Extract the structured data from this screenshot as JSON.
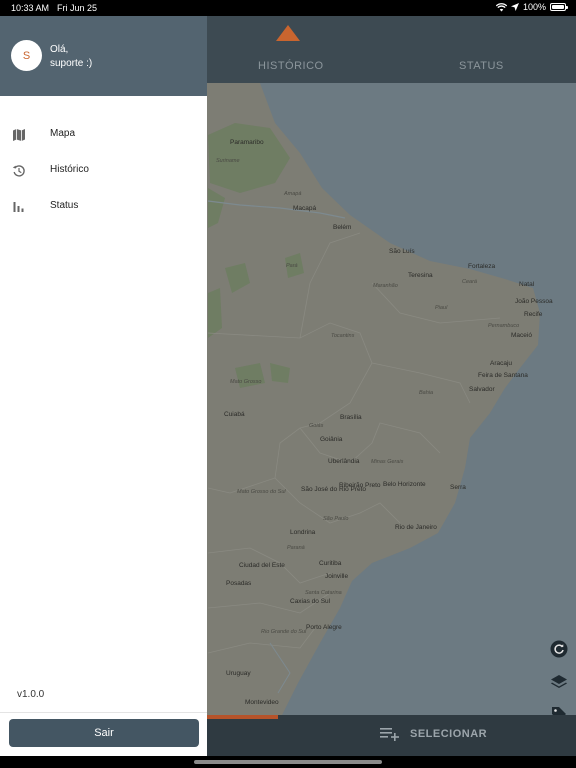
{
  "status_bar": {
    "time": "10:33 AM",
    "date": "Fri Jun 25",
    "battery": "100%",
    "battery_level": 1.0
  },
  "header": {
    "tabs": [
      {
        "label": "HISTÓRICO"
      },
      {
        "label": "STATUS"
      }
    ]
  },
  "map": {
    "places": [
      "Paramaribo",
      "Suriname",
      "Macapá",
      "Belém",
      "São Luís",
      "Fortaleza",
      "Teresina",
      "Natal",
      "João Pessoa",
      "Recife",
      "Maceió",
      "Aracaju",
      "Feira de Santana",
      "Salvador",
      "Brasília",
      "Cuiabá",
      "Goiânia",
      "Uberlândia",
      "Minas Gerais",
      "Mato Grosso do Sul",
      "São José do Rio Preto",
      "Ribeirão Preto",
      "Belo Horizonte",
      "Serra",
      "São Paulo",
      "Rio de Janeiro",
      "Londrina",
      "Paraná",
      "Curitiba",
      "Ciudad del Este",
      "Joinville",
      "Posadas",
      "Santa Catarina",
      "Caxias do Sul",
      "Porto Alegre",
      "Rio Grande do Sul",
      "Uruguay",
      "Montevideo",
      "Mato Grosso",
      "Goiás",
      "Bahia",
      "Tocantins",
      "Pará",
      "Maranhão",
      "Piauí",
      "Ceará",
      "Pernambuco",
      "Amapá"
    ]
  },
  "bottom_bar": {
    "select_label": "SELECIONAR"
  },
  "drawer": {
    "avatar_initial": "S",
    "greeting_line1": "Olá,",
    "greeting_line2": "suporte :)",
    "menu": [
      {
        "label": "Mapa",
        "icon": "map-icon"
      },
      {
        "label": "Histórico",
        "icon": "history-icon"
      },
      {
        "label": "Status",
        "icon": "bar-chart-icon"
      }
    ],
    "version": "v1.0.0",
    "logout_label": "Sair"
  },
  "colors": {
    "accent": "#c9652f",
    "header": "#536470",
    "button": "#445663"
  }
}
